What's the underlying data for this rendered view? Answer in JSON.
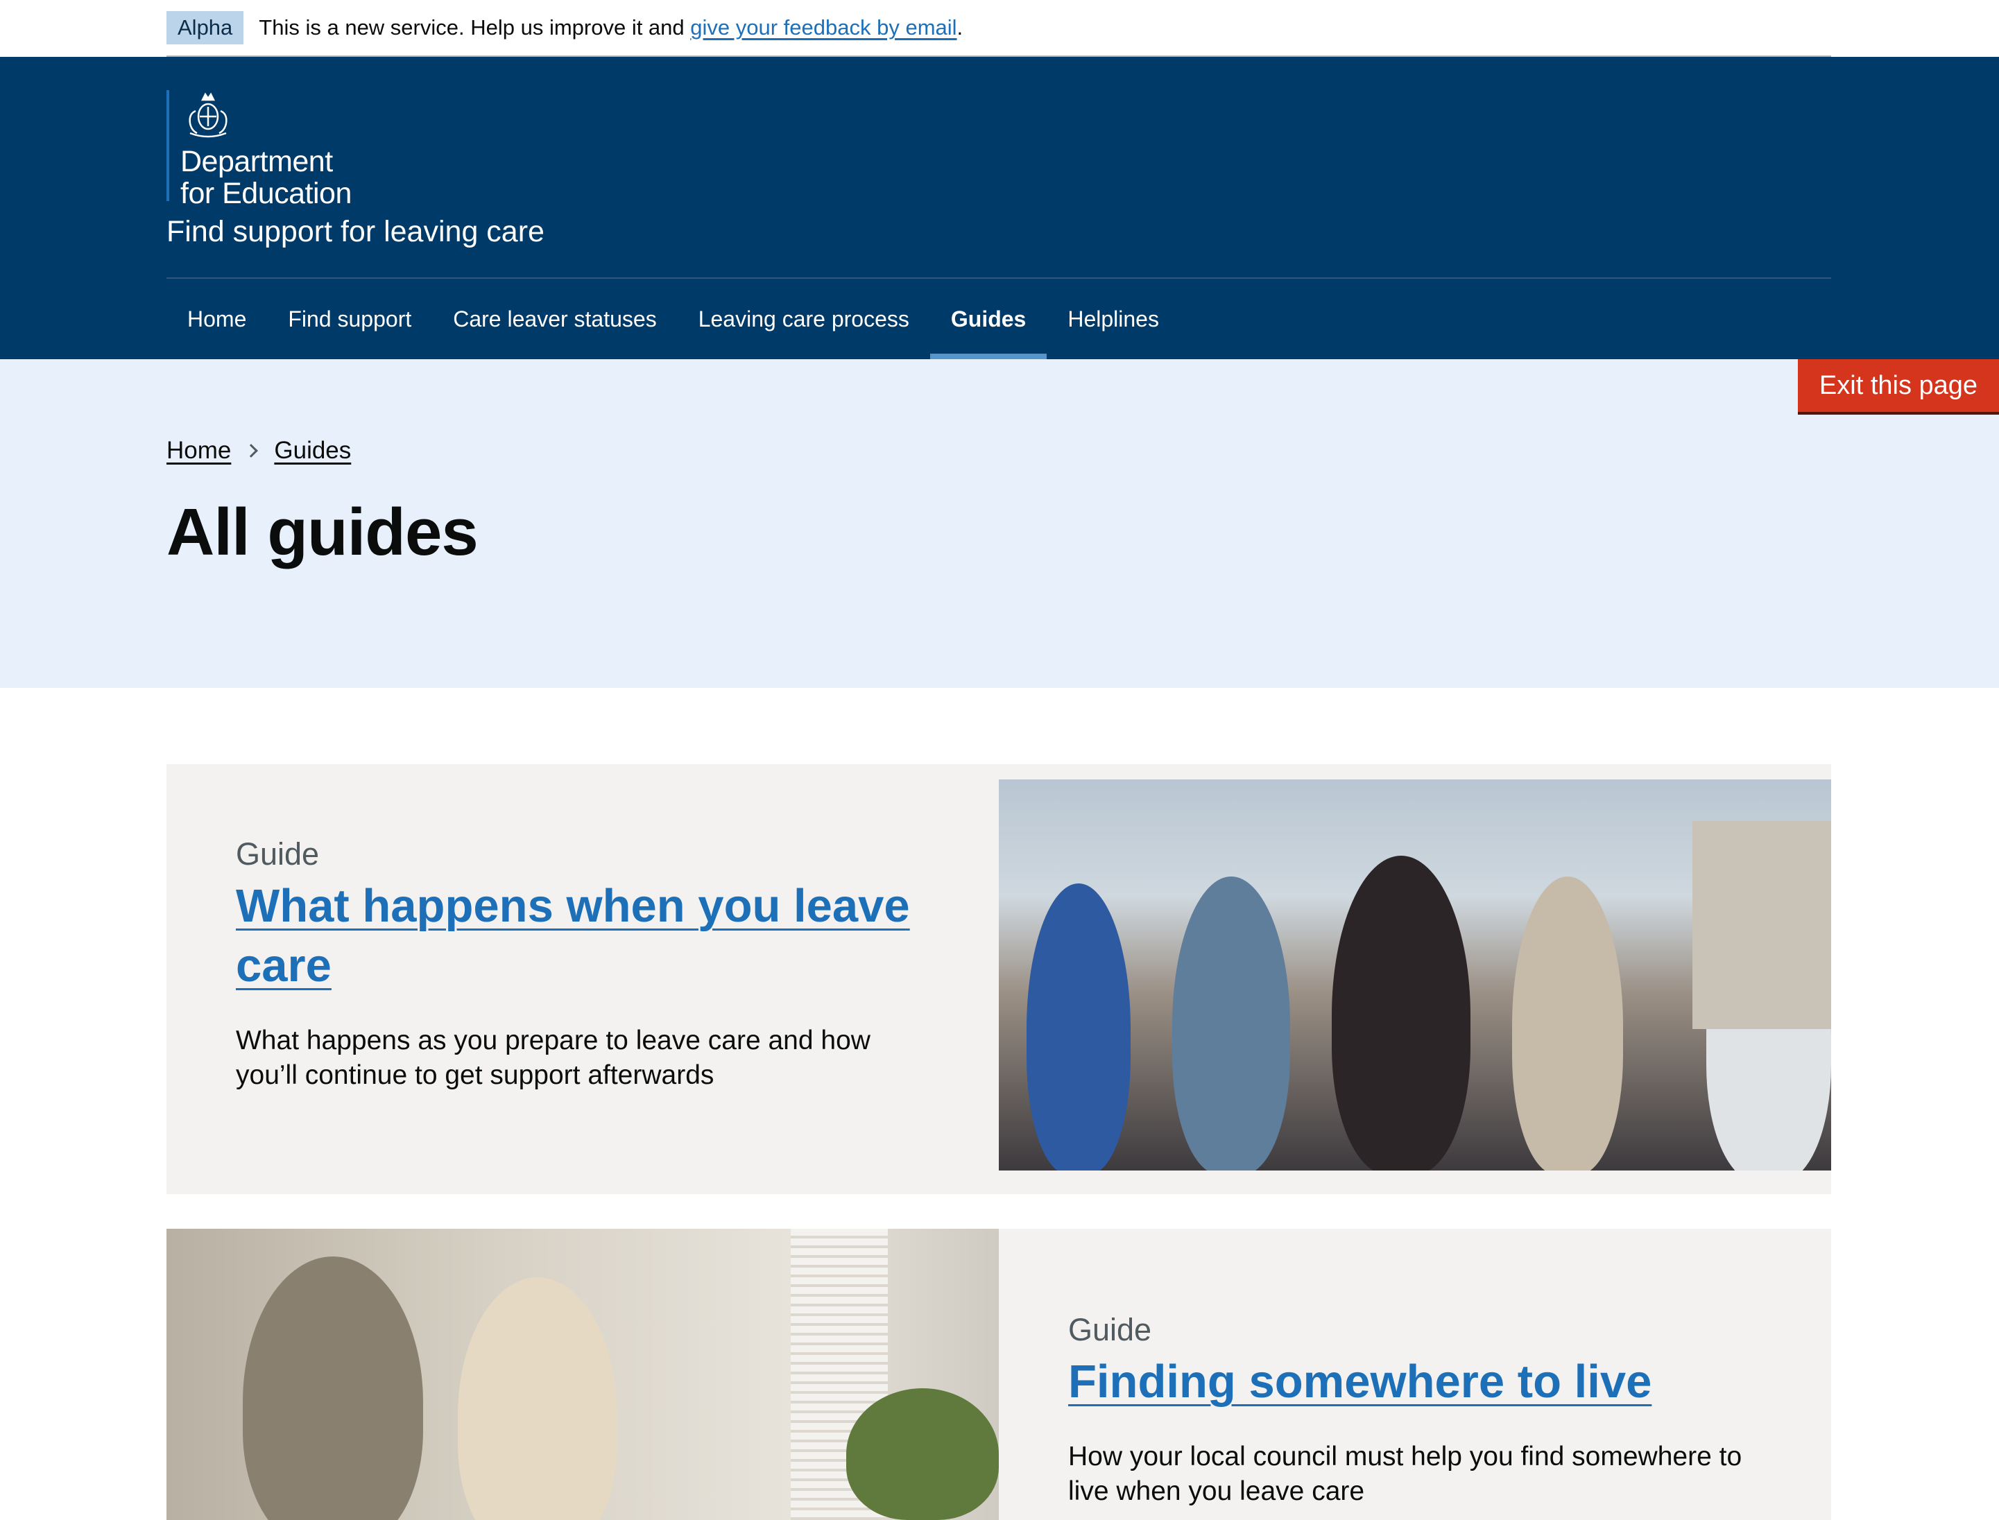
{
  "phase_banner": {
    "tag": "Alpha",
    "text": "This is a new service. Help us improve it and ",
    "link_text": "give your feedback by email",
    "suffix": "."
  },
  "header": {
    "org_line1": "Department",
    "org_line2": "for Education",
    "service_name": "Find support for leaving care",
    "nav": [
      {
        "label": "Home"
      },
      {
        "label": "Find support"
      },
      {
        "label": "Care leaver statuses"
      },
      {
        "label": "Leaving care process"
      },
      {
        "label": "Guides",
        "active": true
      },
      {
        "label": "Helplines"
      }
    ]
  },
  "exit_button": "Exit this page",
  "breadcrumb": [
    "Home",
    "Guides"
  ],
  "page_title": "All guides",
  "cards": [
    {
      "label": "Guide",
      "title": "What happens when you leave care",
      "description": "What happens as you prepare to leave care and how you’ll continue to get support afterwards"
    },
    {
      "label": "Guide",
      "title": "Finding somewhere to live",
      "description": "How your local council must help you find somewhere to live when you leave care"
    }
  ],
  "colors": {
    "header_bg": "#003a69",
    "link": "#1d70b8",
    "hero_bg": "#e8f1fb",
    "exit": "#d4351c",
    "card_bg": "#f3f2f1"
  }
}
